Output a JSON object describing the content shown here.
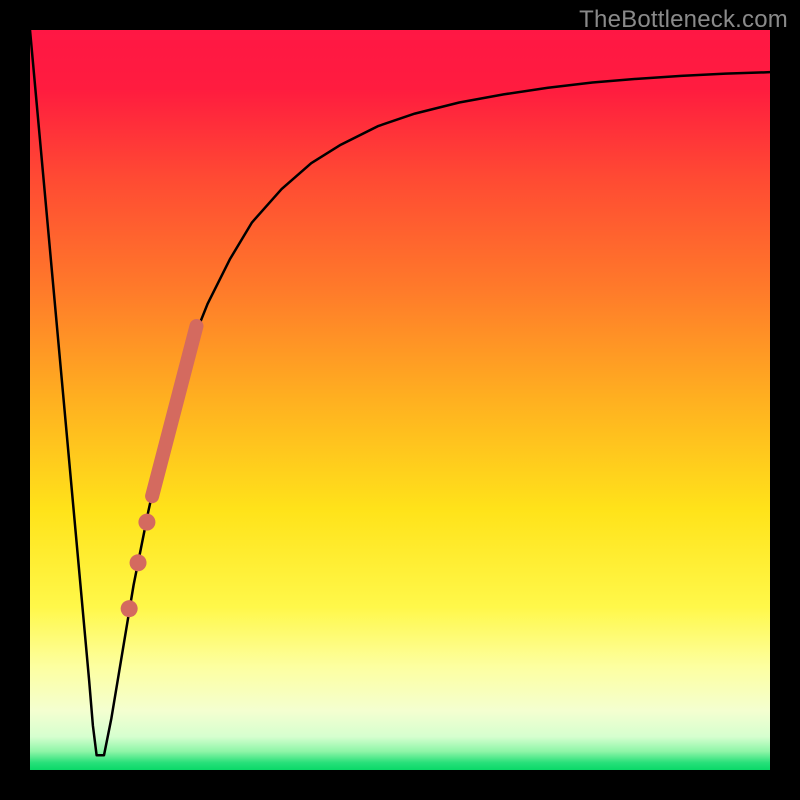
{
  "watermark": "TheBottleneck.com",
  "chart_data": {
    "type": "line",
    "title": "",
    "xlabel": "",
    "ylabel": "",
    "xlim": [
      0,
      100
    ],
    "ylim": [
      0,
      100
    ],
    "grid": false,
    "background_gradient_stops": [
      {
        "offset": 0.0,
        "color": "#ff1744"
      },
      {
        "offset": 0.08,
        "color": "#ff1c3f"
      },
      {
        "offset": 0.2,
        "color": "#ff4a33"
      },
      {
        "offset": 0.35,
        "color": "#ff7a2a"
      },
      {
        "offset": 0.5,
        "color": "#ffb020"
      },
      {
        "offset": 0.65,
        "color": "#ffe31a"
      },
      {
        "offset": 0.78,
        "color": "#fff84a"
      },
      {
        "offset": 0.86,
        "color": "#fdffa0"
      },
      {
        "offset": 0.92,
        "color": "#f4ffd0"
      },
      {
        "offset": 0.955,
        "color": "#d6ffcf"
      },
      {
        "offset": 0.975,
        "color": "#8ef5a7"
      },
      {
        "offset": 0.99,
        "color": "#28e07a"
      },
      {
        "offset": 1.0,
        "color": "#0ad968"
      }
    ],
    "series": [
      {
        "name": "bottleneck-curve",
        "color": "#000000",
        "stroke_width": 2.5,
        "x": [
          0,
          1,
          2,
          3,
          4,
          5,
          6,
          7,
          8,
          8.5,
          9,
          9.5,
          10,
          11,
          12,
          13,
          14,
          15,
          16,
          18,
          20,
          22,
          24,
          27,
          30,
          34,
          38,
          42,
          47,
          52,
          58,
          64,
          70,
          76,
          82,
          88,
          94,
          100
        ],
        "y": [
          100,
          89,
          78,
          67,
          56,
          45,
          34,
          23,
          12,
          6,
          2,
          2,
          2,
          7,
          13,
          19,
          25,
          30,
          35,
          44,
          52,
          58,
          63,
          69,
          74,
          78.5,
          82,
          84.5,
          87,
          88.7,
          90.2,
          91.3,
          92.2,
          92.9,
          93.4,
          93.8,
          94.1,
          94.3
        ]
      }
    ],
    "highlight_band": {
      "name": "highlight-segment",
      "color": "#d46a5f",
      "stroke_width": 14,
      "x": [
        16.5,
        22.5
      ],
      "y": [
        37,
        60
      ]
    },
    "highlight_dots": {
      "name": "highlight-dots",
      "color": "#d46a5f",
      "radius": 8.5,
      "points": [
        {
          "x": 15.8,
          "y": 33.5
        },
        {
          "x": 14.6,
          "y": 28.0
        },
        {
          "x": 13.4,
          "y": 21.8
        }
      ]
    }
  }
}
